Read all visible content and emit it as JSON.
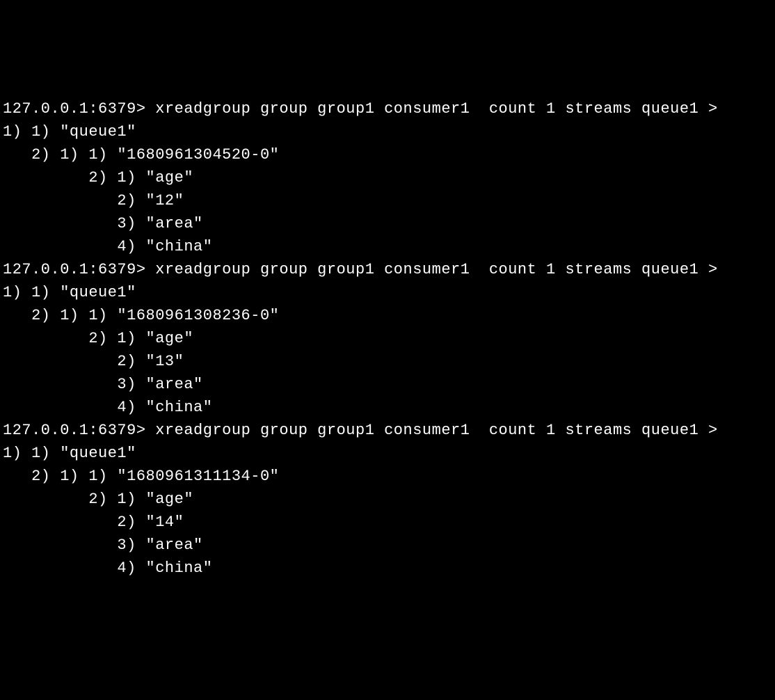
{
  "terminal": {
    "prompt": "127.0.0.1:6379>",
    "command": "xreadgroup group group1 consumer1  count 1 streams queue1 >",
    "entries": [
      {
        "queue_label": "1) 1) \"queue1\"",
        "entry_id_line": "   2) 1) 1) \"1680961304520-0\"",
        "field1_key": "         2) 1) \"age\"",
        "field1_val": "            2) \"12\"",
        "field2_key": "            3) \"area\"",
        "field2_val": "            4) \"china\""
      },
      {
        "queue_label": "1) 1) \"queue1\"",
        "entry_id_line": "   2) 1) 1) \"1680961308236-0\"",
        "field1_key": "         2) 1) \"age\"",
        "field1_val": "            2) \"13\"",
        "field2_key": "            3) \"area\"",
        "field2_val": "            4) \"china\""
      },
      {
        "queue_label": "1) 1) \"queue1\"",
        "entry_id_line": "   2) 1) 1) \"1680961311134-0\"",
        "field1_key": "         2) 1) \"age\"",
        "field1_val": "            2) \"14\"",
        "field2_key": "            3) \"area\"",
        "field2_val": "            4) \"china\""
      }
    ]
  }
}
